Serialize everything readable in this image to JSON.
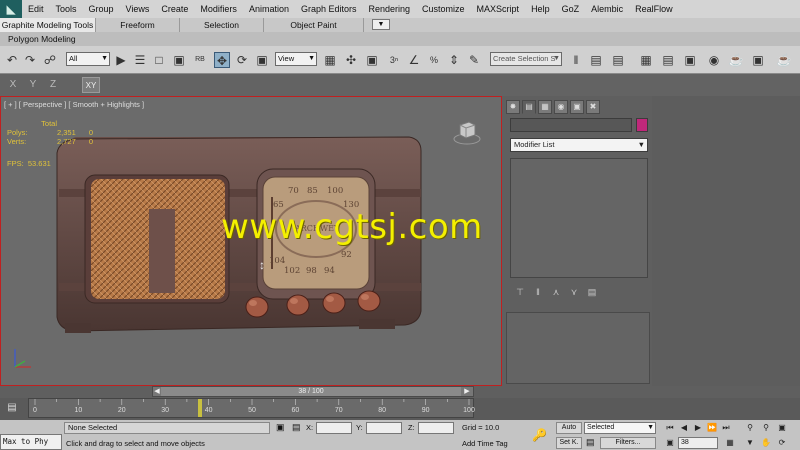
{
  "app": {
    "logo_glyph": "◣"
  },
  "menu": [
    "Edit",
    "Tools",
    "Group",
    "Views",
    "Create",
    "Modifiers",
    "Animation",
    "Graph Editors",
    "Rendering",
    "Customize",
    "MAXScript",
    "Help",
    "GoZ",
    "Alembic",
    "RealFlow"
  ],
  "ribbon": {
    "tabs": [
      "Graphite Modeling Tools",
      "Freeform",
      "Selection",
      "Object Paint"
    ],
    "active_tab": 0,
    "panel_label": "Polygon Modeling"
  },
  "toolbar": {
    "selection_filter": "All",
    "ref_coord": "View",
    "named_selection_placeholder": "Create Selection S"
  },
  "axis": {
    "x": "X",
    "y": "Y",
    "z": "Z",
    "xy": "XY"
  },
  "viewport": {
    "label": "[ + ] [ Perspective ] [ Smooth + Highlights ]",
    "stats_header": "Total",
    "stats": [
      {
        "label": "Polys:",
        "value": "2,351",
        "sel": "0"
      },
      {
        "label": "Verts:",
        "value": "2,727",
        "sel": "0"
      }
    ],
    "fps_label": "FPS:",
    "fps_value": "53.631",
    "watermark": "www.cgtsj.com",
    "dial_numbers": [
      "70",
      "85",
      "100",
      "65",
      "130",
      "104",
      "92",
      "102",
      "98",
      "94"
    ]
  },
  "command_panel": {
    "modifier_list": "Modifier List",
    "object_color": "#c0287a"
  },
  "timeline": {
    "slider_label": "38 / 100",
    "current_frame": 38,
    "ticks": [
      0,
      10,
      20,
      30,
      40,
      50,
      60,
      70,
      80,
      90,
      100
    ]
  },
  "status": {
    "maxscript": "Max to Phy",
    "selection": "None Selected",
    "prompt": "Click and drag to select and move objects",
    "x_label": "X:",
    "y_label": "Y:",
    "z_label": "Z:",
    "grid": "Grid = 10.0",
    "add_time_tag": "Add Time Tag",
    "auto_key": "Auto",
    "set_key": "Set K.",
    "key_filter": "Selected",
    "filters": "Filters...",
    "frame": "38"
  },
  "colors": {
    "viewport_border": "#c02020",
    "stats_text": "#e0c23a",
    "watermark": "#f4f000"
  }
}
